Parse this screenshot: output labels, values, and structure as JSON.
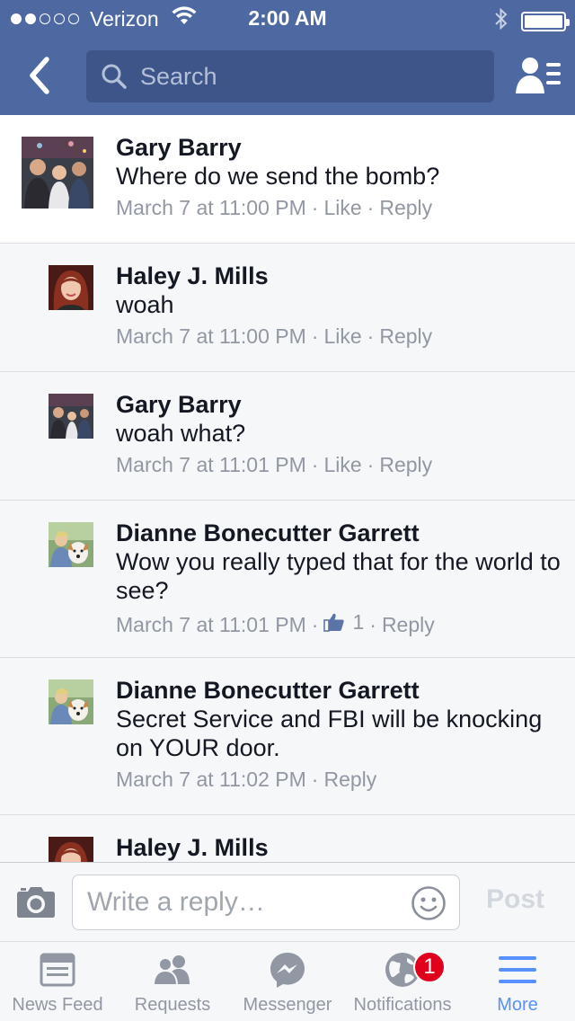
{
  "status_bar": {
    "carrier": "Verizon",
    "time": "2:00 AM",
    "signal_bars_filled": 2,
    "signal_bars_total": 5
  },
  "nav": {
    "search_placeholder": "Search",
    "icons": [
      "back-chevron-icon",
      "search-icon",
      "friends-icon"
    ]
  },
  "comments": [
    {
      "author": "Gary Barry",
      "text": "Where do we send the bomb?",
      "time": "March 7 at 11:00 PM",
      "like": "Like",
      "reply": "Reply",
      "avatar": "group-photo"
    },
    {
      "author": "Haley J. Mills",
      "text": "woah",
      "time": "March 7 at 11:00 PM",
      "like": "Like",
      "reply": "Reply",
      "avatar": "woman-photo"
    },
    {
      "author": "Gary Barry",
      "text": "woah what?",
      "time": "March 7 at 11:01 PM",
      "like": "Like",
      "reply": "Reply",
      "avatar": "group-photo"
    },
    {
      "author": "Dianne Bonecutter Garrett",
      "text": "Wow you really typed that for the world to see?",
      "time": "March 7 at 11:01 PM",
      "like_count": "1",
      "reply": "Reply",
      "avatar": "dog-photo"
    },
    {
      "author": "Dianne Bonecutter Garrett",
      "text": "Secret Service and FBI will be knocking on YOUR door.",
      "time": "March 7 at 11:02 PM",
      "reply": "Reply",
      "avatar": "dog-photo"
    },
    {
      "author": "Haley J. Mills",
      "avatar": "woman-photo"
    }
  ],
  "composer": {
    "placeholder": "Write a reply…",
    "post_label": "Post"
  },
  "tabs": [
    {
      "label": "News Feed",
      "icon": "news-feed-icon",
      "active": false
    },
    {
      "label": "Requests",
      "icon": "requests-icon",
      "active": false
    },
    {
      "label": "Messenger",
      "icon": "messenger-icon",
      "active": false
    },
    {
      "label": "Notifications",
      "icon": "globe-icon",
      "active": false,
      "badge": "1"
    },
    {
      "label": "More",
      "icon": "menu-icon",
      "active": true
    }
  ],
  "colors": {
    "header": "#4e69a2",
    "search_bg": "#3d5588",
    "active_tab": "#5890ff",
    "meta_text": "#9197a3",
    "badge": "#e0001b"
  }
}
